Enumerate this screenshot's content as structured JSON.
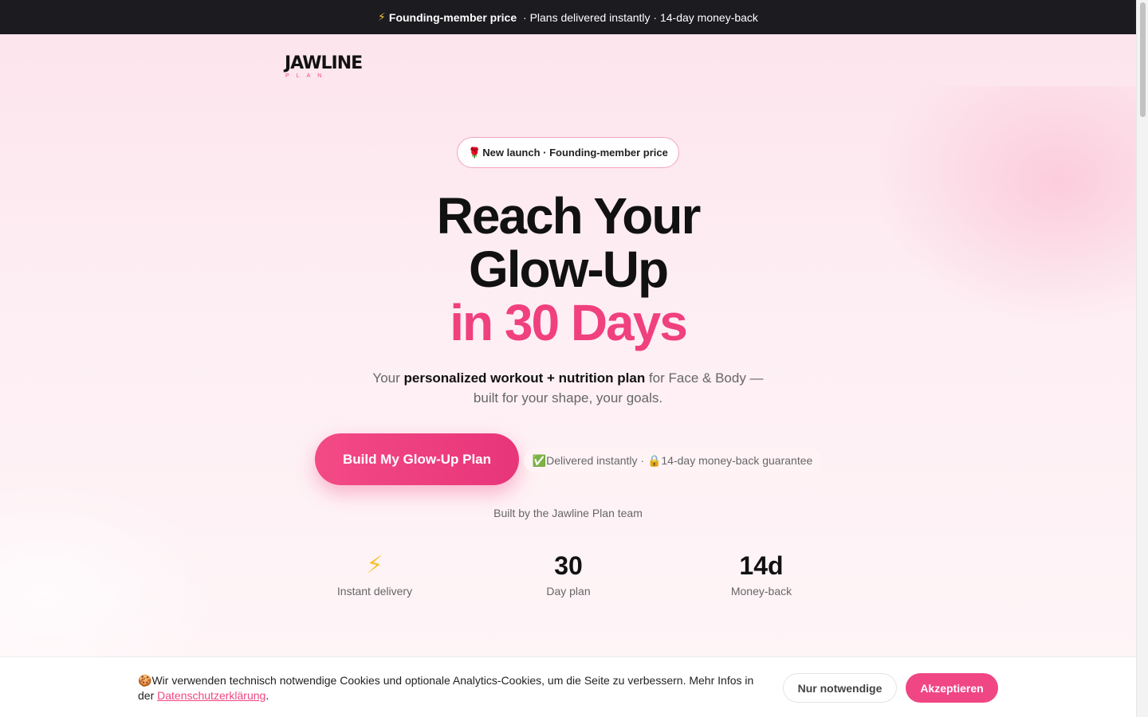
{
  "topbar": {
    "bolt": "⚡",
    "highlight": "Founding-member price",
    "rest": " · Plans delivered instantly · 14-day money-back"
  },
  "logo": {
    "main": "JAWLINE",
    "sub": "PLAN"
  },
  "badge": {
    "emoji": "🌹",
    "text": "New launch · Founding-member price"
  },
  "hero": {
    "line1": "Reach Your",
    "line2": "Glow-Up",
    "line3": "in 30 Days",
    "sub_pre": "Your ",
    "sub_bold": "personalized workout + nutrition plan",
    "sub_post": " for Face & Body — built for your shape, your goals."
  },
  "cta": {
    "label": "Build My Glow-Up Plan"
  },
  "guarantee": {
    "text": "✅Delivered instantly · 🔒14-day money-back guarantee"
  },
  "built_by": "Built by the Jawline Plan team",
  "stats": [
    {
      "value": "⚡",
      "label": "Instant delivery"
    },
    {
      "value": "30",
      "label": "Day plan"
    },
    {
      "value": "14d",
      "label": "Money-back"
    }
  ],
  "cookie": {
    "emoji": "🍪",
    "text": "Wir verwenden technisch notwendige Cookies und optionale Analytics-Cookies, um die Seite zu verbessern. Mehr Infos in der ",
    "link": "Datenschutzerklärung",
    "after": ".",
    "necessary_label": "Nur notwendige",
    "accept_label": "Akzeptieren"
  },
  "colors": {
    "accent": "#f04683",
    "dark": "#1b1b20",
    "background": "#fde3ec"
  }
}
